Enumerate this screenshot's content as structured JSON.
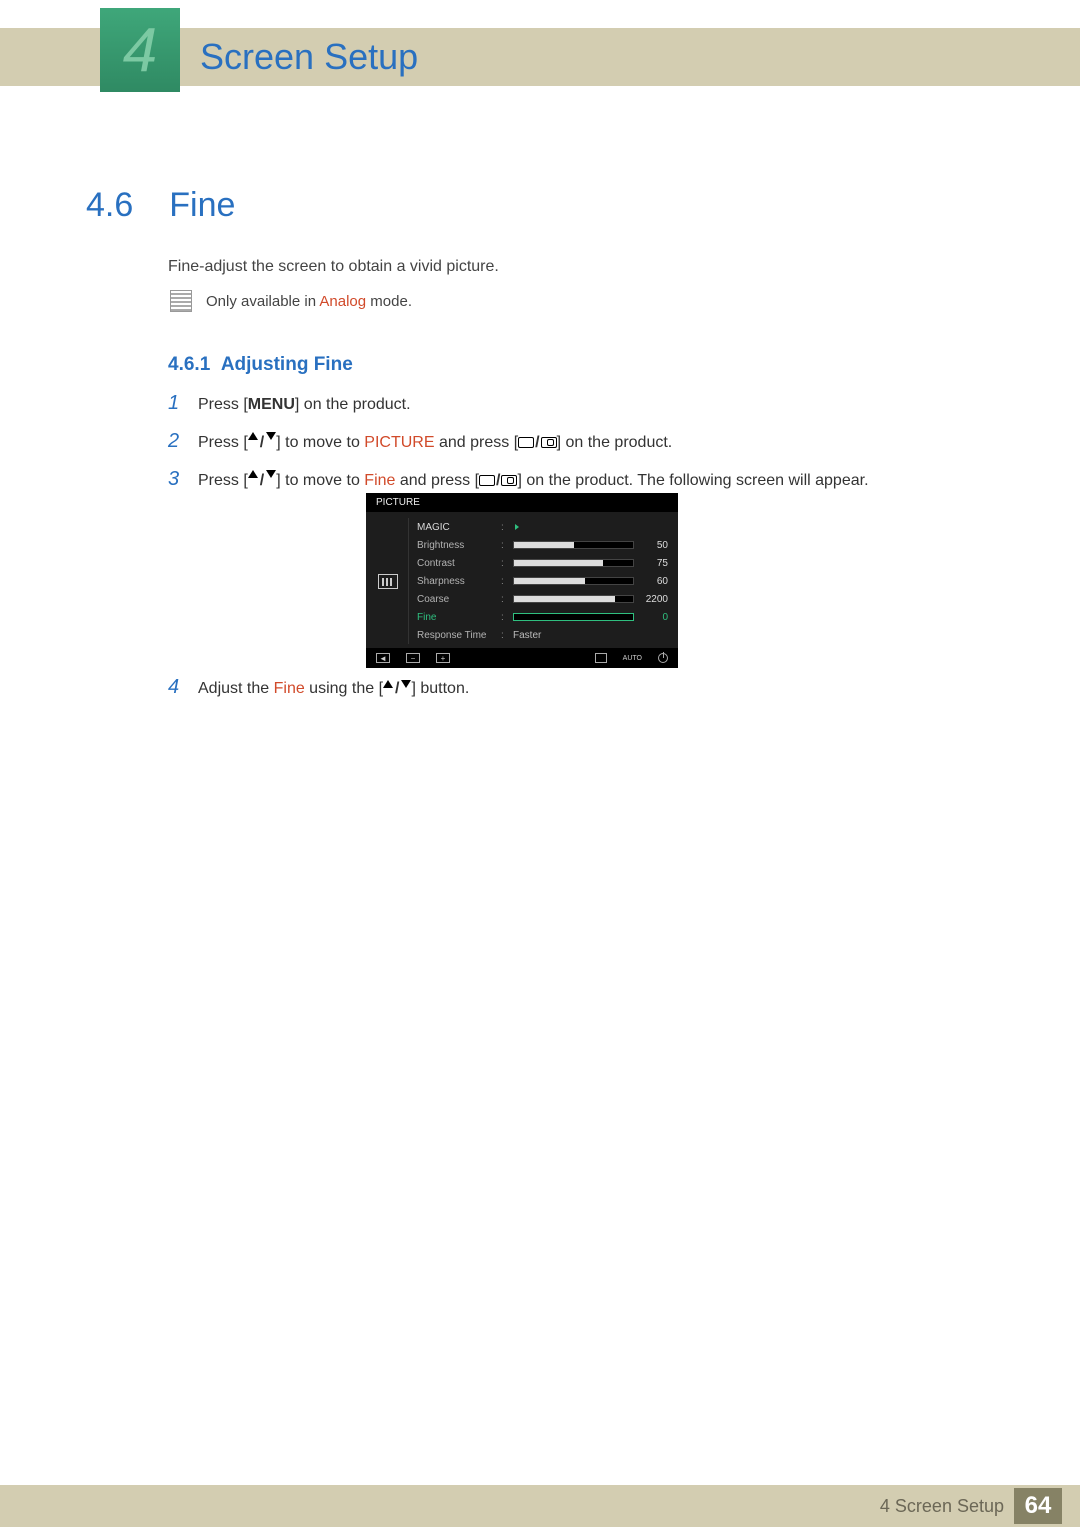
{
  "header": {
    "chapter_number": "4",
    "chapter_title": "Screen Setup"
  },
  "section": {
    "number": "4.6",
    "title": "Fine",
    "intro": "Fine-adjust the screen to obtain a vivid picture.",
    "note_prefix": "Only available in ",
    "note_analog": "Analog",
    "note_suffix": " mode."
  },
  "subsection": {
    "number": "4.6.1",
    "title": "Adjusting Fine"
  },
  "steps": {
    "s1": {
      "n": "1",
      "a": "Press [",
      "menu": "MENU",
      "b": "] on the product."
    },
    "s2": {
      "n": "2",
      "a": "Press [",
      "b": "] to move to ",
      "picture": "PICTURE",
      "c": " and press [",
      "d": "] on the product."
    },
    "s3": {
      "n": "3",
      "a": "Press [",
      "b": "] to move to ",
      "fine": "Fine",
      "c": " and press [",
      "d": "] on the product. The following screen will appear."
    },
    "s4": {
      "n": "4",
      "a": "Adjust the ",
      "fine": "Fine",
      "b": " using the [",
      "c": "] button."
    }
  },
  "osd": {
    "header": "PICTURE",
    "items": {
      "magic": "MAGIC",
      "brightness": {
        "label": "Brightness",
        "value": "50",
        "pct": 50
      },
      "contrast": {
        "label": "Contrast",
        "value": "75",
        "pct": 75
      },
      "sharpness": {
        "label": "Sharpness",
        "value": "60",
        "pct": 60
      },
      "coarse": {
        "label": "Coarse",
        "value": "2200",
        "pct": 85
      },
      "fine": {
        "label": "Fine",
        "value": "0",
        "pct": 0
      },
      "response": {
        "label": "Response Time",
        "value": "Faster"
      }
    },
    "footer_auto": "AUTO"
  },
  "footer": {
    "chapter": "4 Screen Setup",
    "page": "64"
  }
}
